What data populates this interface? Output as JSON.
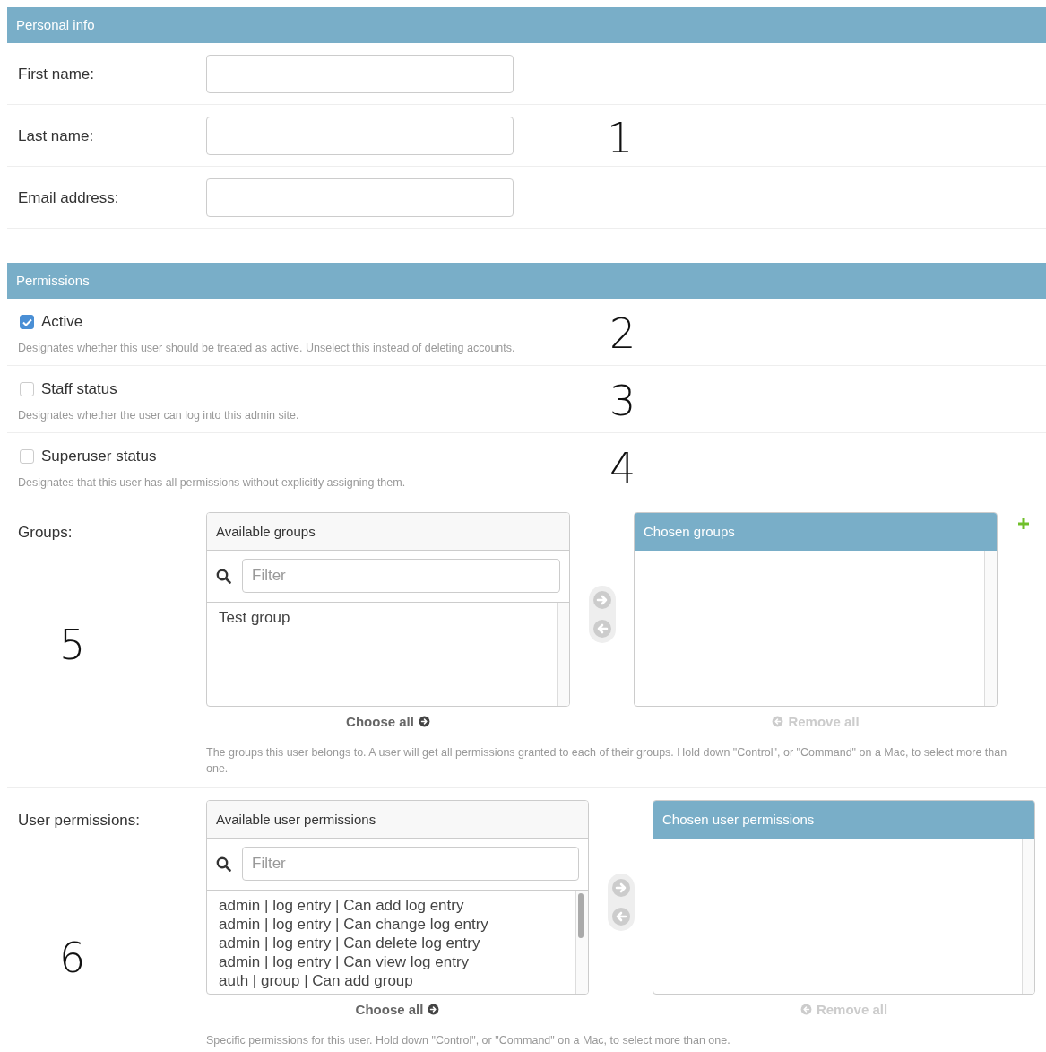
{
  "sections": [
    {
      "title": "Personal info",
      "rows": [
        {
          "kind": "text",
          "label": "First name:"
        },
        {
          "kind": "text",
          "label": "Last name:",
          "annotation": "1"
        },
        {
          "kind": "text",
          "label": "Email address:"
        }
      ]
    },
    {
      "title": "Permissions",
      "rows": [
        {
          "kind": "checkbox",
          "label": "Active",
          "checked": true,
          "help": "Designates whether this user should be treated as active. Unselect this instead of deleting accounts.",
          "annotation": "2"
        },
        {
          "kind": "checkbox",
          "label": "Staff status",
          "checked": false,
          "help": "Designates whether the user can log into this admin site.",
          "annotation": "3"
        },
        {
          "kind": "checkbox",
          "label": "Superuser status",
          "checked": false,
          "help": "Designates that this user has all permissions without explicitly assigning them.",
          "annotation": "4"
        },
        {
          "kind": "selector",
          "label": "Groups:",
          "annotation": "5",
          "available": {
            "title": "Available groups",
            "placeholder": "Filter",
            "options": [
              "Test group"
            ]
          },
          "chosen": {
            "title": "Chosen groups"
          },
          "move_buttons": [
            {
              "kind": "add",
              "disabled": true
            },
            {
              "kind": "remove",
              "disabled": true
            }
          ],
          "choose_all": {
            "label": "Choose all",
            "disabled": false
          },
          "remove_all": {
            "label": "Remove all",
            "disabled": true
          },
          "add_link": true,
          "help": "The groups this user belongs to. A user will get all permissions granted to each of their groups. Hold down \"Control\", or \"Command\" on a Mac, to select more than one."
        },
        {
          "kind": "selector",
          "label": "User permissions:",
          "annotation": "6",
          "available": {
            "title": "Available user permissions",
            "placeholder": "Filter",
            "options": [
              "admin | log entry | Can add log entry",
              "admin | log entry | Can change log entry",
              "admin | log entry | Can delete log entry",
              "admin | log entry | Can view log entry",
              "auth | group | Can add group"
            ]
          },
          "chosen": {
            "title": "Chosen user permissions"
          },
          "move_buttons": [
            {
              "kind": "add",
              "disabled": true
            },
            {
              "kind": "remove",
              "disabled": true
            }
          ],
          "choose_all": {
            "label": "Choose all",
            "disabled": false
          },
          "remove_all": {
            "label": "Remove all",
            "disabled": true
          },
          "add_link": false,
          "help": "Specific permissions for this user. Hold down \"Control\", or \"Command\" on a Mac, to select more than one."
        }
      ]
    }
  ]
}
